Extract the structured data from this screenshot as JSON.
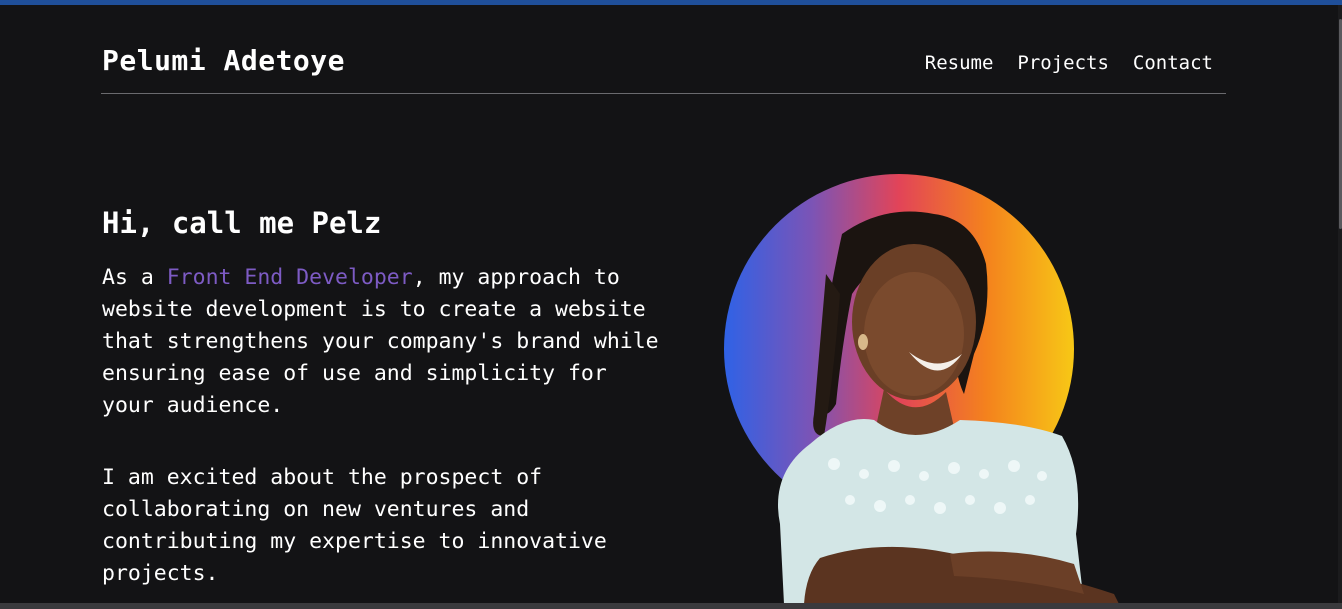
{
  "header": {
    "brand": "Pelumi Adetoye",
    "nav": [
      {
        "label": "Resume"
      },
      {
        "label": "Projects"
      },
      {
        "label": "Contact"
      }
    ]
  },
  "hero": {
    "greeting": "Hi, call me Pelz",
    "intro_prefix": "As a ",
    "intro_role": "Front End Developer",
    "intro_rest": ", my approach to website development is to create a website that strengthens your company's brand while ensuring ease of use and simplicity for your audience.",
    "second_paragraph": "I am excited about the prospect of collaborating on new ventures and contributing my expertise to innovative projects."
  },
  "colors": {
    "background": "#131315",
    "accent": "#7d5bc4",
    "gradient": [
      "#2f62e6",
      "#7b54b6",
      "#e24458",
      "#f4821d",
      "#f7c816"
    ]
  }
}
